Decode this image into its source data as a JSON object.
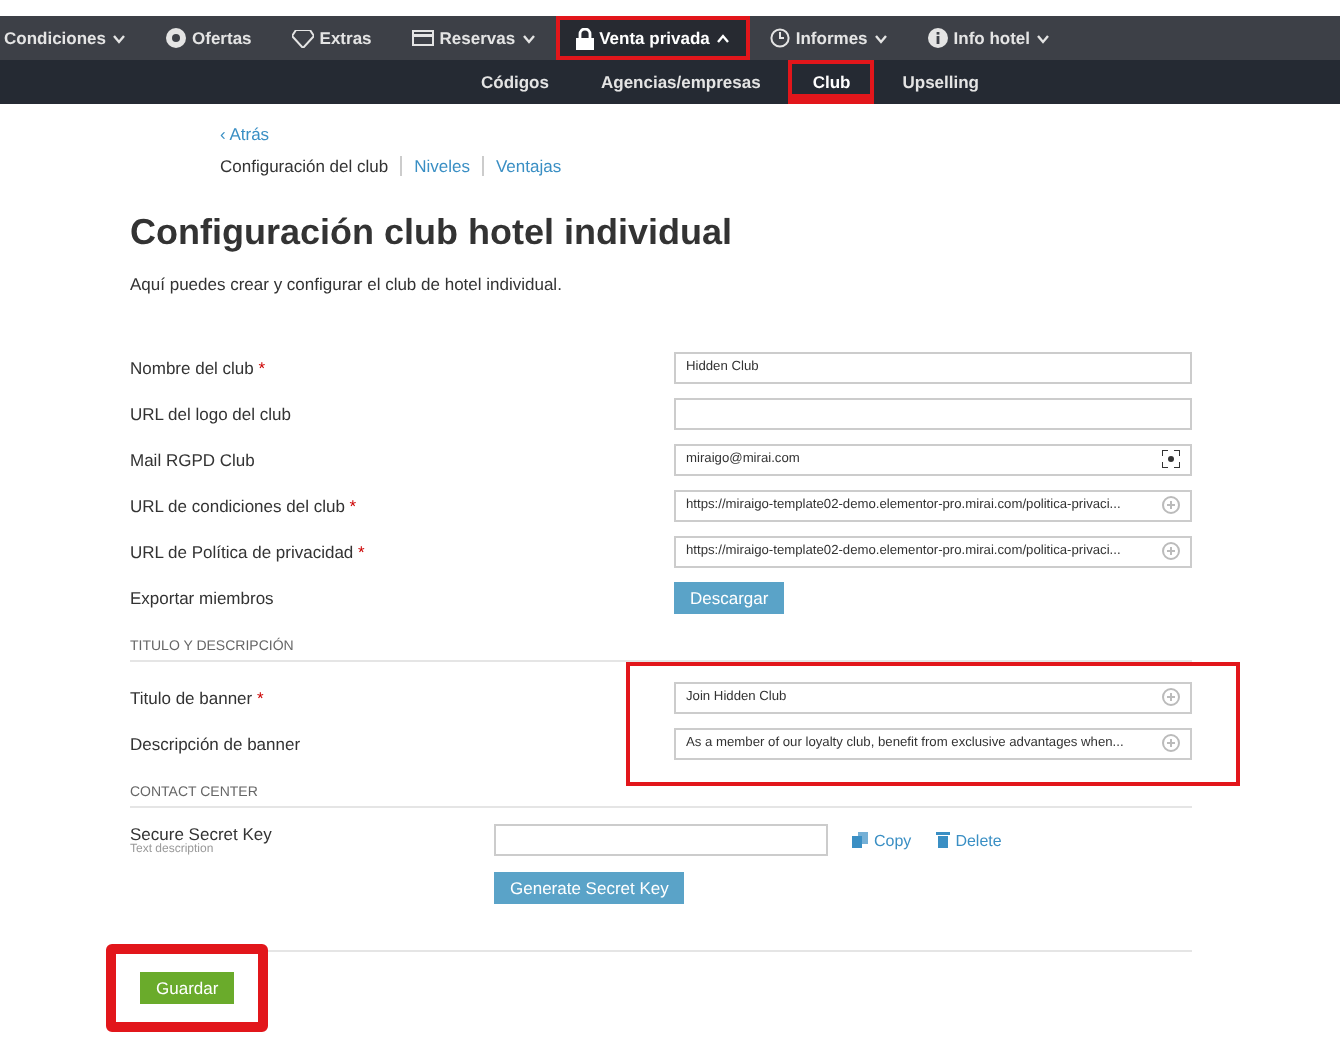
{
  "nav": {
    "items": [
      {
        "label": "Condiciones",
        "expanded": false,
        "selected": false,
        "highlighted": false
      },
      {
        "label": "Ofertas",
        "selected": false,
        "highlighted": false
      },
      {
        "label": "Extras",
        "selected": false,
        "highlighted": false
      },
      {
        "label": "Reservas",
        "expanded": false,
        "selected": false,
        "highlighted": false
      },
      {
        "label": "Venta privada",
        "expanded": true,
        "selected": true,
        "highlighted": true
      },
      {
        "label": "Informes",
        "expanded": false,
        "selected": false,
        "highlighted": false
      },
      {
        "label": "Info hotel",
        "expanded": false,
        "selected": false,
        "highlighted": false
      }
    ]
  },
  "subnav": {
    "items": [
      {
        "label": "Códigos",
        "selected": false,
        "highlighted": false
      },
      {
        "label": "Agencias/empresas",
        "selected": false,
        "highlighted": false
      },
      {
        "label": "Club",
        "selected": true,
        "highlighted": true
      },
      {
        "label": "Upselling",
        "selected": false,
        "highlighted": false
      }
    ]
  },
  "back_link": "‹ Atrás",
  "tabs": [
    {
      "label": "Configuración del club",
      "selected": true
    },
    {
      "label": "Niveles",
      "selected": false
    },
    {
      "label": "Ventajas",
      "selected": false
    }
  ],
  "title": "Configuración club hotel individual",
  "intro": "Aquí puedes crear y configurar el club de hotel individual.",
  "fields": [
    {
      "kind": "text",
      "label": "Nombre del club",
      "required_mark": "*",
      "value": "Hidden Club"
    },
    {
      "kind": "text",
      "label": "URL del logo del club"
    },
    {
      "kind": "email",
      "label": "Mail RGPD Club",
      "value": "miraigo@mirai.com"
    },
    {
      "kind": "url",
      "label": "URL de condiciones del club",
      "required_mark": "*",
      "value": "https://miraigo-template02-demo.elementor-pro.mirai.com/politica-privaci..."
    },
    {
      "kind": "url",
      "label": "URL de Política de privacidad",
      "required_mark": "*",
      "value": "https://miraigo-template02-demo.elementor-pro.mirai.com/politica-privaci..."
    },
    {
      "kind": "button",
      "label": "Exportar miembros",
      "button": "Descargar"
    }
  ],
  "banner_section": {
    "heading": "TITULO Y DESCRIPCIÓN",
    "highlighted": true,
    "fields": [
      {
        "label": "Titulo de banner",
        "required_mark": "*",
        "value": "Join Hidden Club"
      },
      {
        "label": "Descripción de banner",
        "value": "As a member of our loyalty club, benefit from exclusive advantages when..."
      }
    ]
  },
  "contact_center": {
    "heading": "CONTACT CENTER",
    "label": "Secure Secret Key",
    "hint": "Text description",
    "copy": "Copy",
    "delete": "Delete",
    "generate": "Generate Secret Key"
  },
  "save": {
    "label": "Guardar",
    "highlighted": true
  }
}
